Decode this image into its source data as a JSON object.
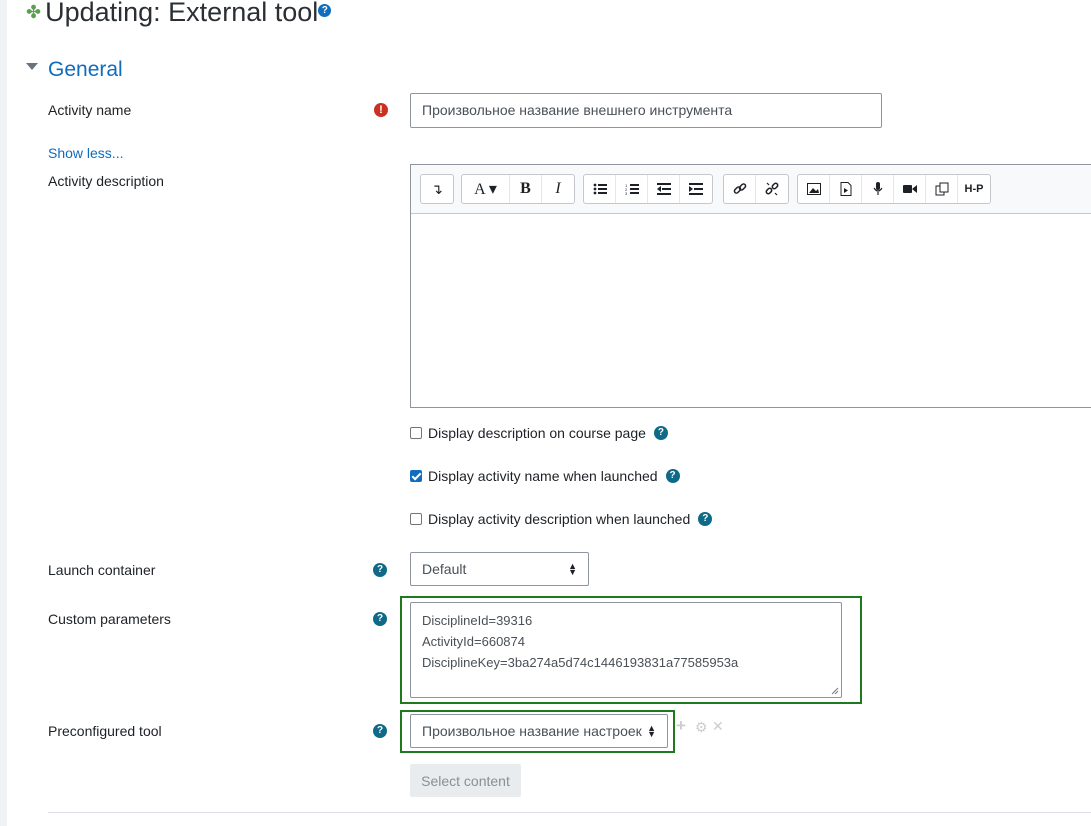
{
  "page": {
    "title": "Updating: External tool"
  },
  "section": {
    "title": "General"
  },
  "activity_name": {
    "label": "Activity name",
    "value": "Произвольное название внешнего инструмента"
  },
  "show_less": "Show less...",
  "description": {
    "label": "Activity description"
  },
  "checkboxes": [
    {
      "label": "Display description on course page",
      "checked": false
    },
    {
      "label": "Display activity name when launched",
      "checked": true
    },
    {
      "label": "Display activity description when launched",
      "checked": false
    }
  ],
  "launch_container": {
    "label": "Launch container",
    "value": "Default"
  },
  "custom_parameters": {
    "label": "Custom parameters",
    "lines": [
      "DisciplineId=39316",
      "ActivityId=660874",
      "DisciplineKey=3ba274a5d74c1446193831a77585953a"
    ]
  },
  "preconfigured_tool": {
    "label": "Preconfigured tool",
    "value": "Произвольное название настроек"
  },
  "select_content": {
    "label": "Select content"
  },
  "colors": {
    "accent": "#0f6cbf",
    "help": "#0f6a88",
    "error": "#ca3120",
    "highlight": "#1f7a1f"
  }
}
